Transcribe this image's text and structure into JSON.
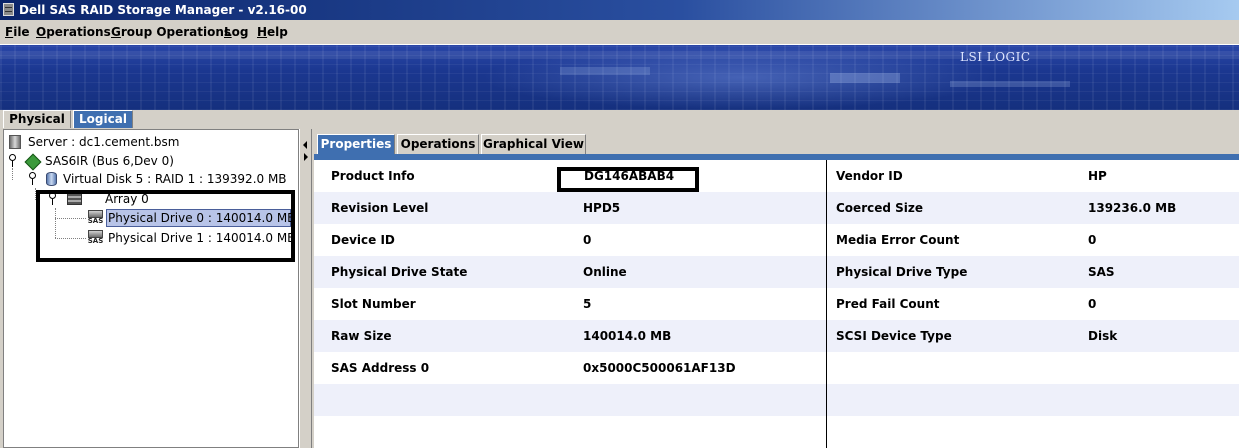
{
  "window": {
    "title": "Dell SAS RAID Storage Manager - v2.16-00"
  },
  "menu": [
    {
      "label": "File",
      "mnemonic": "F",
      "rest": "ile"
    },
    {
      "label": "Operations",
      "mnemonic": "O",
      "rest": "perations"
    },
    {
      "label": "Group Operations",
      "mnemonic": "G",
      "rest": "roup Operations"
    },
    {
      "label": "Log",
      "mnemonic": "L",
      "rest": "og"
    },
    {
      "label": "Help",
      "mnemonic": "H",
      "rest": "elp"
    }
  ],
  "banner": {
    "logo_text": "LSI LOGIC"
  },
  "left_tabs": {
    "physical": "Physical",
    "logical": "Logical",
    "active": "Logical"
  },
  "tree": {
    "server": "Server : dc1.cement.bsm",
    "controller": "SAS6IR (Bus 6,Dev 0)",
    "virtual_disk": "Virtual Disk 5 : RAID 1 : 139392.0 MB",
    "array": "Array 0",
    "drive0": "Physical Drive 0 : 140014.0 MB",
    "drive1": "Physical Drive 1 : 140014.0 MB",
    "sas_tag": "SAS",
    "selected": "Physical Drive 0 : 140014.0 MB"
  },
  "right_tabs": {
    "properties": "Properties",
    "operations": "Operations",
    "graphical": "Graphical View",
    "active": "Properties"
  },
  "properties": {
    "left": [
      {
        "label": "Product Info",
        "value": "DG146ABAB4"
      },
      {
        "label": "Revision Level",
        "value": "HPD5"
      },
      {
        "label": "Device ID",
        "value": "0"
      },
      {
        "label": "Physical Drive State",
        "value": "Online"
      },
      {
        "label": "Slot Number",
        "value": "5"
      },
      {
        "label": "Raw Size",
        "value": "140014.0 MB"
      },
      {
        "label": "SAS Address 0",
        "value": "0x5000C500061AF13D"
      }
    ],
    "right": [
      {
        "label": "Vendor ID",
        "value": "HP"
      },
      {
        "label": "Coerced Size",
        "value": "139236.0 MB"
      },
      {
        "label": "Media Error Count",
        "value": "0"
      },
      {
        "label": "Physical Drive Type",
        "value": "SAS"
      },
      {
        "label": "Pred Fail Count",
        "value": "0"
      },
      {
        "label": "SCSI Device Type",
        "value": "Disk"
      }
    ]
  },
  "colors": {
    "titlebar_start": "#0a246a",
    "active_tab": "#3f6fb0",
    "row_alt": "#eef0fa",
    "selection": "#b8c4e8",
    "highlight_box": "#000000"
  }
}
